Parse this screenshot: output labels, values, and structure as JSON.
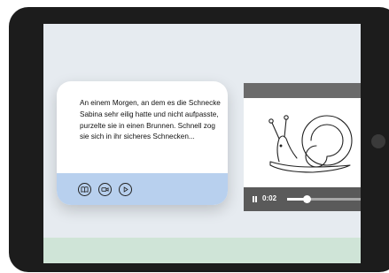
{
  "story_card": {
    "text": "An einem Morgen, an dem es die Schnecke Sabina sehr eilig hatte und nicht aufpasste, purzelte sie in einen Brunnen. Schnell zog sie sich in ihr sicheres Schnecken..."
  },
  "card_actions": [
    {
      "name": "book-button",
      "icon": "book-icon"
    },
    {
      "name": "video-button",
      "icon": "video-camera-icon"
    },
    {
      "name": "play-button",
      "icon": "play-icon"
    }
  ],
  "video_player": {
    "time": "0:02",
    "progress": 0.22,
    "illustration": "snail"
  },
  "colors": {
    "tablet_frame": "#1c1c1c",
    "screen_background": "#e6ebf0",
    "card_footer": "#b8d0ee",
    "player_bar": "#5a5a5a",
    "bottom_strip": "#cfe4d7"
  }
}
